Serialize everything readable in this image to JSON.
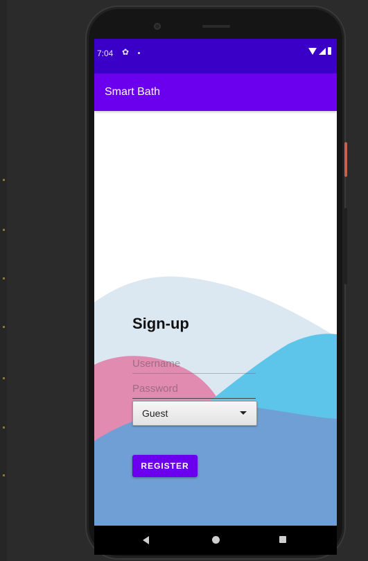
{
  "status_bar": {
    "time": "7:04",
    "icons": [
      "gear-icon",
      "notification-dot-icon",
      "wifi-icon",
      "signal-icon",
      "battery-icon"
    ]
  },
  "app_bar": {
    "title": "Smart Bath",
    "color": "#6a00ee"
  },
  "form": {
    "title": "Sign-up",
    "username_placeholder": "Username",
    "password_placeholder": "Password",
    "role_select_value": "Guest",
    "register_label": "REGISTER"
  },
  "colors": {
    "status_bar": "#3a00c8",
    "accent": "#6a00ee",
    "wave_light": "#dbe7f1",
    "wave_pink": "#e28bb1",
    "wave_cyan": "#5ec5ea",
    "wave_blue": "#6f9fd4"
  },
  "nav_bar": {
    "icons": [
      "back-icon",
      "home-icon",
      "recent-apps-icon"
    ]
  }
}
